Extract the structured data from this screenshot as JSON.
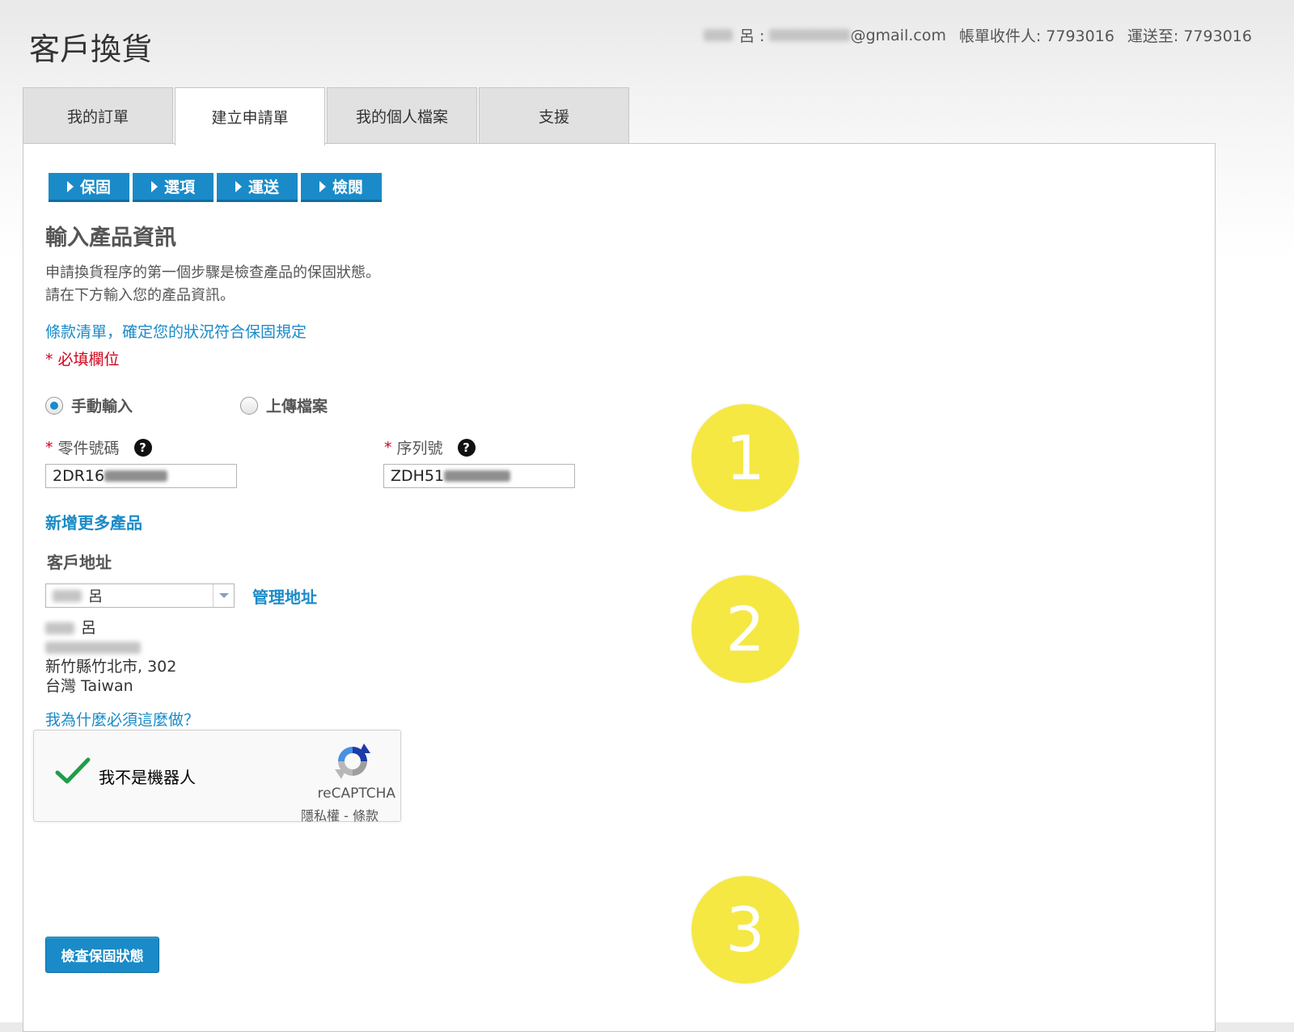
{
  "page": {
    "title": "客戶換貨"
  },
  "account": {
    "name_suffix": "呂 :",
    "email_suffix": "@gmail.com",
    "billing": "帳單收件人: 7793016",
    "shipping": "運送至: 7793016"
  },
  "tabs": [
    {
      "label": "我的訂單",
      "active": false
    },
    {
      "label": "建立申請單",
      "active": true
    },
    {
      "label": "我的個人檔案",
      "active": false
    },
    {
      "label": "支援",
      "active": false
    }
  ],
  "steps": [
    {
      "label": "保固"
    },
    {
      "label": "選項"
    },
    {
      "label": "運送"
    },
    {
      "label": "檢閱"
    }
  ],
  "form": {
    "section_title": "輸入產品資訊",
    "intro_line1": "申請換貨程序的第一個步驟是檢查產品的保固狀態。",
    "intro_line2": "請在下方輸入您的產品資訊。",
    "terms_link": "條款清單，確定您的狀況符合保固規定",
    "required_note": "* 必填欄位",
    "input_modes": [
      {
        "label": "手動輸入",
        "selected": true
      },
      {
        "label": "上傳檔案",
        "selected": false
      }
    ],
    "part_number": {
      "label": "零件號碼",
      "value_prefix": "2DR16"
    },
    "serial_number": {
      "label": "序列號",
      "value_prefix": "ZDH51"
    },
    "required_marker": "*",
    "help_icon": "?",
    "add_more_link": "新增更多產品",
    "address_title": "客戶地址",
    "address_select_value": "呂",
    "manage_address_link": "管理地址",
    "address": {
      "name": "呂",
      "city_line": "新竹縣竹北市, 302",
      "country_line": "台灣 Taiwan"
    },
    "why_link": "我為什麼必須這麼做？",
    "captcha": {
      "label": "我不是機器人",
      "brand": "reCAPTCHA",
      "terms": "隱私權 - 條款",
      "checked": true
    },
    "submit_label": "檢查保固狀態"
  },
  "markers": [
    "1",
    "2",
    "3"
  ],
  "colors": {
    "accent": "#1a8bc8",
    "required": "#d0021b",
    "marker": "#f5e843"
  },
  "icons": {
    "help": "question-circle-icon",
    "step": "triangle-right-icon",
    "select_arrow": "chevron-down-icon",
    "captcha_check": "checkmark-icon",
    "captcha_logo": "recaptcha-logo-icon"
  }
}
